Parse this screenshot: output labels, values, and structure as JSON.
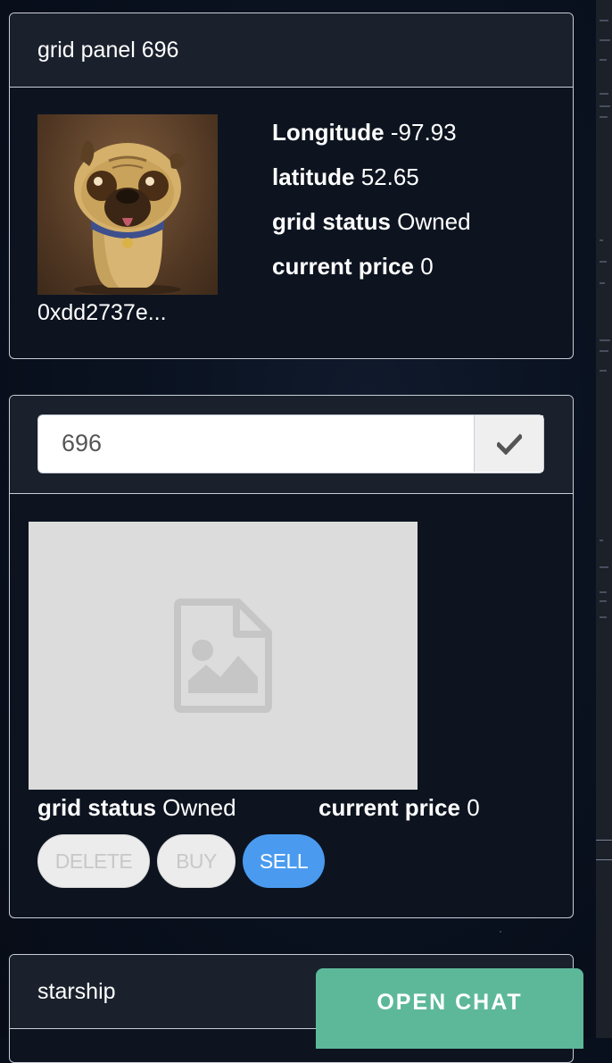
{
  "grid_panel": {
    "title": "grid panel 696",
    "owner": "0xdd2737e...",
    "longitude_label": "Longitude",
    "longitude_value": "-97.93",
    "latitude_label": "latitude",
    "latitude_value": "52.65",
    "status_label": "grid status",
    "status_value": "Owned",
    "price_label": "current price",
    "price_value": "0"
  },
  "edit_panel": {
    "search_value": "696",
    "status_label": "grid status",
    "status_value": "Owned",
    "price_label": "current price",
    "price_value": "0",
    "buttons": {
      "delete": "DELETE",
      "buy": "BUY",
      "sell": "SELL"
    }
  },
  "starship_panel": {
    "title": "starship"
  },
  "chat": {
    "label": "OPEN CHAT"
  },
  "colors": {
    "background": "#0a1220",
    "panel_border": "#c9ced6",
    "sell_button": "#4a9bf0",
    "chat_button": "#5db89a"
  },
  "icons": [
    "checkmark-icon",
    "image-placeholder-icon"
  ]
}
